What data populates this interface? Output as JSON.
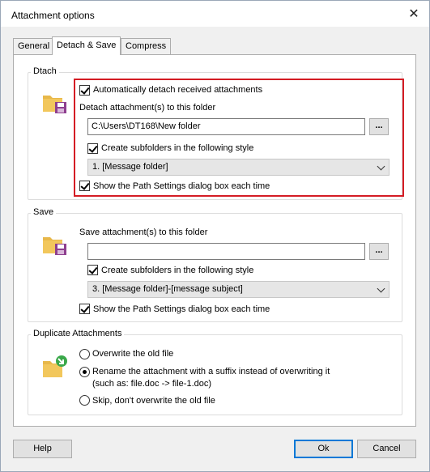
{
  "window": {
    "title": "Attachment options"
  },
  "tabs": [
    {
      "label": "General"
    },
    {
      "label": "Detach & Save"
    },
    {
      "label": "Compress"
    }
  ],
  "detach": {
    "group_label": "Dtach",
    "auto_detach_label": "Automatically detach received attachments",
    "auto_detach_checked": true,
    "folder_label": "Detach attachment(s) to this folder",
    "folder_value": "C:\\Users\\DT168\\New folder",
    "browse_label": "...",
    "subfolders_label": "Create subfolders in the following style",
    "subfolders_checked": true,
    "style_value": "1. [Message folder]",
    "show_path_label": "Show the Path Settings dialog box each time",
    "show_path_checked": true
  },
  "save": {
    "group_label": "Save",
    "folder_label": "Save attachment(s) to this folder",
    "folder_value": "",
    "browse_label": "...",
    "subfolders_label": "Create subfolders in the following style",
    "subfolders_checked": true,
    "style_value": "3. [Message folder]-[message subject]",
    "show_path_label": "Show the Path Settings dialog box each time",
    "show_path_checked": true
  },
  "duplicate": {
    "group_label": "Duplicate Attachments",
    "options": [
      {
        "label": "Overwrite the old file",
        "selected": false
      },
      {
        "label": "Rename the attachment with a suffix instead of overwriting it",
        "selected": true,
        "note": "(such as: file.doc -> file-1.doc)"
      },
      {
        "label": "Skip, don't overwrite the old file",
        "selected": false
      }
    ]
  },
  "buttons": {
    "help": "Help",
    "ok": "Ok",
    "cancel": "Cancel"
  },
  "colors": {
    "highlight": "#d41c24",
    "folder": "#e8b84a",
    "disk": "#8e3f8f",
    "arrow": "#3aa84a"
  }
}
